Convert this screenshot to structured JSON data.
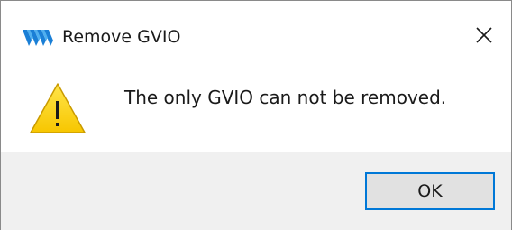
{
  "window": {
    "title": "Remove GVIO",
    "app_icon": "gowin-logo-icon",
    "close_icon": "close-icon"
  },
  "message": {
    "icon": "warning-icon",
    "text": "The only GVIO can not be removed."
  },
  "buttons": {
    "ok_label": "OK"
  },
  "colors": {
    "accent": "#0078d7",
    "footer_bg": "#f0f0f0",
    "button_bg": "#e1e1e1",
    "warning_fill": "#ffd700",
    "logo_blue": "#1a7fd6"
  }
}
